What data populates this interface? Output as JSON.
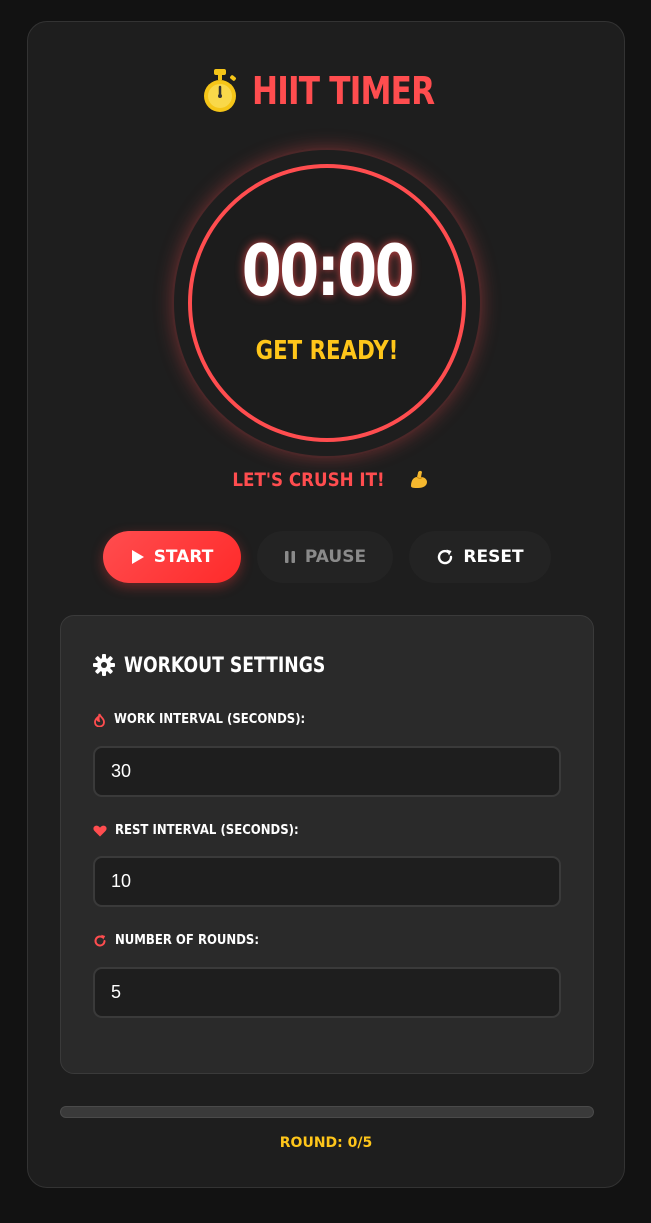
{
  "app": {
    "title": "HIIT TIMER",
    "title_icon": "stopwatch-icon"
  },
  "timer": {
    "time": "00:00",
    "phase": "GET READY!",
    "motivation": "LET'S CRUSH IT!",
    "motivation_icon": "flexed-bicep-icon"
  },
  "controls": {
    "start_label": "START",
    "start_icon": "play-icon",
    "pause_label": "PAUSE",
    "pause_icon": "pause-icon",
    "reset_label": "RESET",
    "reset_icon": "reset-icon"
  },
  "settings": {
    "title": "WORKOUT SETTINGS",
    "title_icon": "gear-icon",
    "work": {
      "label": "WORK INTERVAL (SECONDS):",
      "value": "30",
      "icon": "fire-icon"
    },
    "rest": {
      "label": "REST INTERVAL (SECONDS):",
      "value": "10",
      "icon": "heart-icon"
    },
    "rounds": {
      "label": "NUMBER OF ROUNDS:",
      "value": "5",
      "icon": "rotate-icon"
    }
  },
  "progress": {
    "fraction": 0,
    "round_text": "ROUND: 0/5"
  },
  "colors": {
    "accent": "#ff4d4f",
    "highlight": "#ffc61a",
    "background": "#121212",
    "card": "#1e1e1e",
    "panel": "#2a2a2a"
  }
}
